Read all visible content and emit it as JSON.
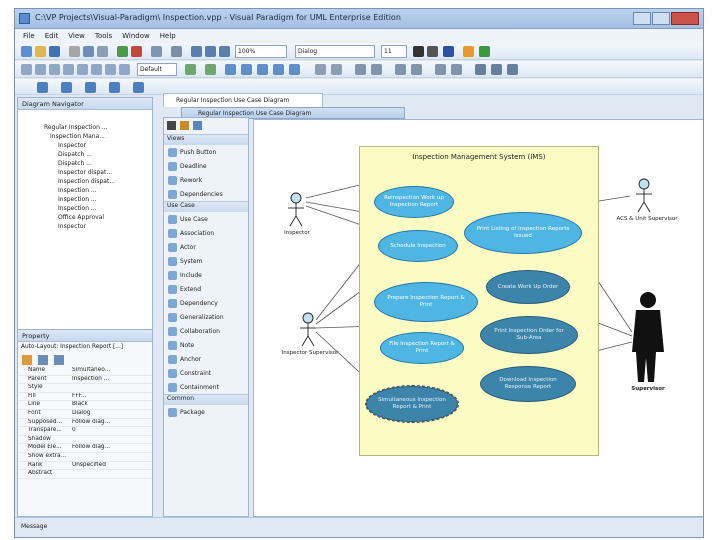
{
  "window": {
    "title": "C:\\VP Projects\\Visual-Paradigm\\ Inspection.vpp - Visual Paradigm for UML Enterprise Edition"
  },
  "menu": [
    "File",
    "Edit",
    "View",
    "Tools",
    "Window",
    "Help"
  ],
  "toolbar": {
    "zoom": "100%",
    "font": "Dialog",
    "font_size": "11",
    "style": "Default"
  },
  "diagram_navigator": {
    "title": "Diagram Navigator",
    "items": [
      "Regular Inspection ...",
      "Inspection Mana...",
      "Inspector",
      "Dispatch ...",
      "Dispatch ...",
      "Inspector dispat...",
      "Inspection dispat...",
      "Inspection ...",
      "Inspection ...",
      "Inspection ...",
      "Office Approval",
      "Inspector"
    ]
  },
  "properties": {
    "title": "Property",
    "subject": "Auto-Layout: Inspection Report [...]",
    "rows": [
      {
        "k": "Name",
        "v": "Simultaneo..."
      },
      {
        "k": "Parent",
        "v": "Inspection ..."
      },
      {
        "k": "Style",
        "v": ""
      },
      {
        "k": "Fill",
        "v": "FFF..."
      },
      {
        "k": "Line",
        "v": "Black"
      },
      {
        "k": "Font",
        "v": "Dialog"
      },
      {
        "k": "Supposed...",
        "v": "Follow diag..."
      },
      {
        "k": "Transpare...",
        "v": "0"
      },
      {
        "k": "Shadow",
        "v": ""
      },
      {
        "k": "Model Ele...",
        "v": "Follow diag..."
      },
      {
        "k": "Show extra...",
        "v": ""
      },
      {
        "k": "Rank",
        "v": "Unspecified"
      },
      {
        "k": "Abstract",
        "v": ""
      }
    ]
  },
  "tabs": {
    "doc": "Regular Inspection Use Case Diagram",
    "inner": "Regular Inspection Use Case Diagram"
  },
  "palette": {
    "group1": "Views",
    "group1_items": [
      "Push Button",
      "Deadline",
      "Rework",
      "Dependencies"
    ],
    "group2": "Use Case",
    "group2_items": [
      "Use Case",
      "Association",
      "Actor",
      "System",
      "Include",
      "Extend",
      "Dependency",
      "Generalization",
      "Collaboration",
      "Note",
      "Anchor",
      "Constraint",
      "Containment"
    ],
    "group3": "Common",
    "group3_items": [
      "Package"
    ]
  },
  "diagram": {
    "system_title": "Inspection Management System (IMS)",
    "use_cases": [
      "Reinspection Work up Inspection Report",
      "Schedule Inspection",
      "Prepare Inspection Report & Print",
      "File Inspection Report & Print",
      "Simultaneous Inspection Report & Print",
      "Print Listing of Inspection Reports Issued",
      "Create Work Up Order",
      "Print Inspection Order for Sub-Area",
      "Download Inspection Response Report"
    ],
    "actors": [
      "Inspector",
      "Inspector Supervisor",
      "ACS & Unit Supervisor",
      "Supervisor"
    ]
  },
  "status": {
    "left": "Message",
    "right": ""
  },
  "colors": {
    "usecase_light": "#4fb6e3",
    "usecase_dark": "#3d84ab",
    "system_fill": "#fdfbc4"
  }
}
